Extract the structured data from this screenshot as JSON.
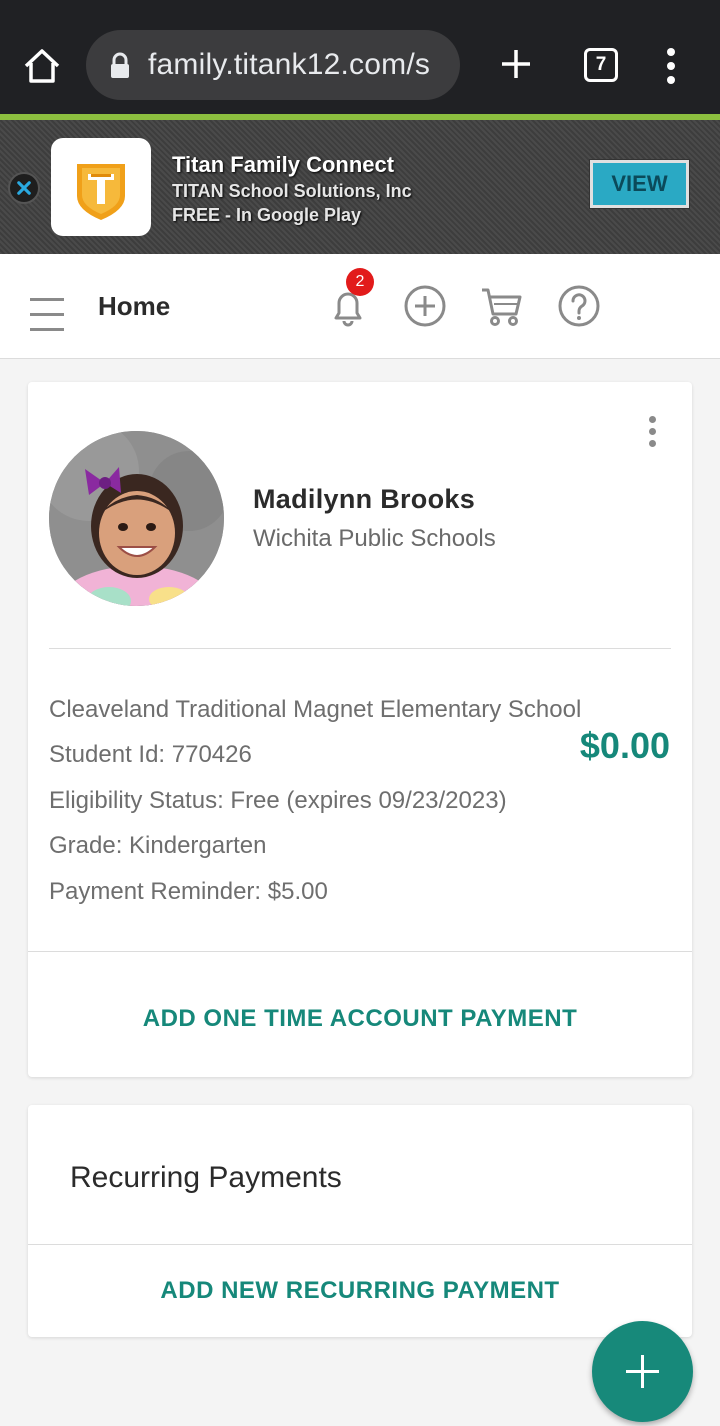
{
  "browser": {
    "url": "family.titank12.com/s",
    "tab_count": "7"
  },
  "app_banner": {
    "app_name": "Titan Family Connect",
    "publisher": "TITAN School Solutions, Inc",
    "store_text": "FREE - In Google Play",
    "view_label": "VIEW"
  },
  "nav": {
    "title": "Home",
    "notification_count": "2",
    "icons": [
      "menu-icon",
      "bell-icon",
      "add-circle-icon",
      "cart-icon",
      "help-icon"
    ]
  },
  "student": {
    "name": "Madilynn Brooks",
    "district": "Wichita Public Schools",
    "school": "Cleaveland Traditional Magnet Elementary School",
    "student_id": "Student Id: 770426",
    "eligibility": "Eligibility Status: Free (expires 09/23/2023)",
    "grade": "Grade: Kindergarten",
    "payment_reminder": "Payment Reminder: $5.00",
    "balance": "$0.00",
    "action_label": "ADD ONE TIME ACCOUNT PAYMENT"
  },
  "recurring": {
    "title": "Recurring Payments",
    "action_label": "ADD NEW RECURRING PAYMENT"
  },
  "colors": {
    "accent": "#16887a",
    "badge": "#e21b1b",
    "banner_green": "#8cbf3f",
    "view_button": "#2aa9c4"
  }
}
